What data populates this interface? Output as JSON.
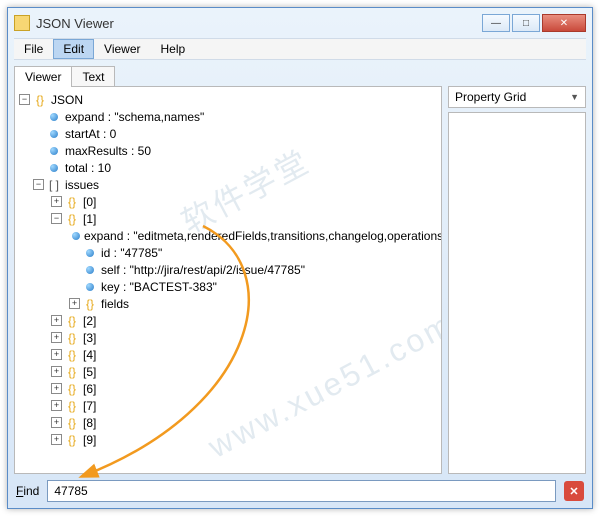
{
  "window": {
    "title": "JSON Viewer"
  },
  "menu": {
    "file": "File",
    "edit": "Edit",
    "viewer": "Viewer",
    "help": "Help"
  },
  "tabs": {
    "viewer": "Viewer",
    "text": "Text"
  },
  "property_grid": {
    "title": "Property Grid"
  },
  "find": {
    "label_prefix": "F",
    "label_rest": "ind",
    "value": "47785"
  },
  "watermark": {
    "text1": "软件学堂",
    "text2": "www.xue51.com"
  },
  "tree": {
    "root": "JSON",
    "expand": "expand : \"schema,names\"",
    "startAt": "startAt : 0",
    "maxResults": "maxResults : 50",
    "total": "total : 10",
    "issues": "issues",
    "idx0": "[0]",
    "idx1": "[1]",
    "i1_expand": "expand : \"editmeta,renderedFields,transitions,changelog,operations\"",
    "i1_id": "id : \"47785\"",
    "i1_self": "self : \"http://jira/rest/api/2/issue/47785\"",
    "i1_key": "key : \"BACTEST-383\"",
    "i1_fields": "fields",
    "idx2": "[2]",
    "idx3": "[3]",
    "idx4": "[4]",
    "idx5": "[5]",
    "idx6": "[6]",
    "idx7": "[7]",
    "idx8": "[8]",
    "idx9": "[9]"
  }
}
